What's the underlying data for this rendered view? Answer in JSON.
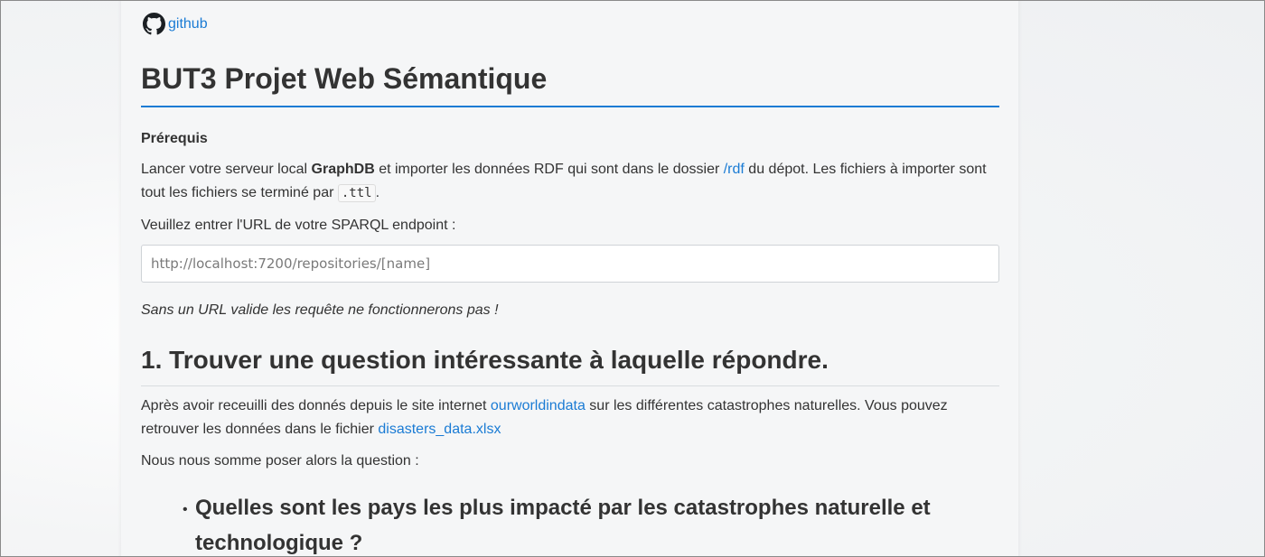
{
  "github": {
    "label": "github",
    "icon": "github-icon"
  },
  "page_title": "BUT3 Projet Web Sémantique",
  "prereq": {
    "heading": "Prérequis",
    "p1_a": "Lancer votre serveur local ",
    "p1_bold": "GraphDB",
    "p1_b": " et importer les données RDF qui sont dans le dossier ",
    "p1_link": "/rdf",
    "p1_c": " du dépot. Les fichiers à importer sont tout les fichiers se terminé par ",
    "p1_code": ".ttl",
    "p1_d": ".",
    "endpoint_label": "Veuillez entrer l'URL de votre SPARQL endpoint :",
    "endpoint_placeholder": "http://localhost:7200/repositories/[name]",
    "endpoint_value": "",
    "warning": "Sans un URL valide les requête ne fonctionnerons pas !"
  },
  "section1": {
    "title": "1. Trouver une question intéressante à laquelle répondre.",
    "p1_a": "Après avoir receuilli des donnés depuis le site internet ",
    "p1_link": "ourworldindata",
    "p1_b": " sur les différentes catastrophes naturelles. Vous pouvez retrouver les données dans le fichier ",
    "p1_link2": "disasters_data.xlsx",
    "p2": "Nous nous somme poser alors la question :",
    "question": "Quelles sont les pays les plus impacté par les catastrophes naturelle et technologique ?"
  },
  "colors": {
    "link": "#1a7bd4",
    "text": "#333333",
    "rule": "#1a7bd4"
  }
}
